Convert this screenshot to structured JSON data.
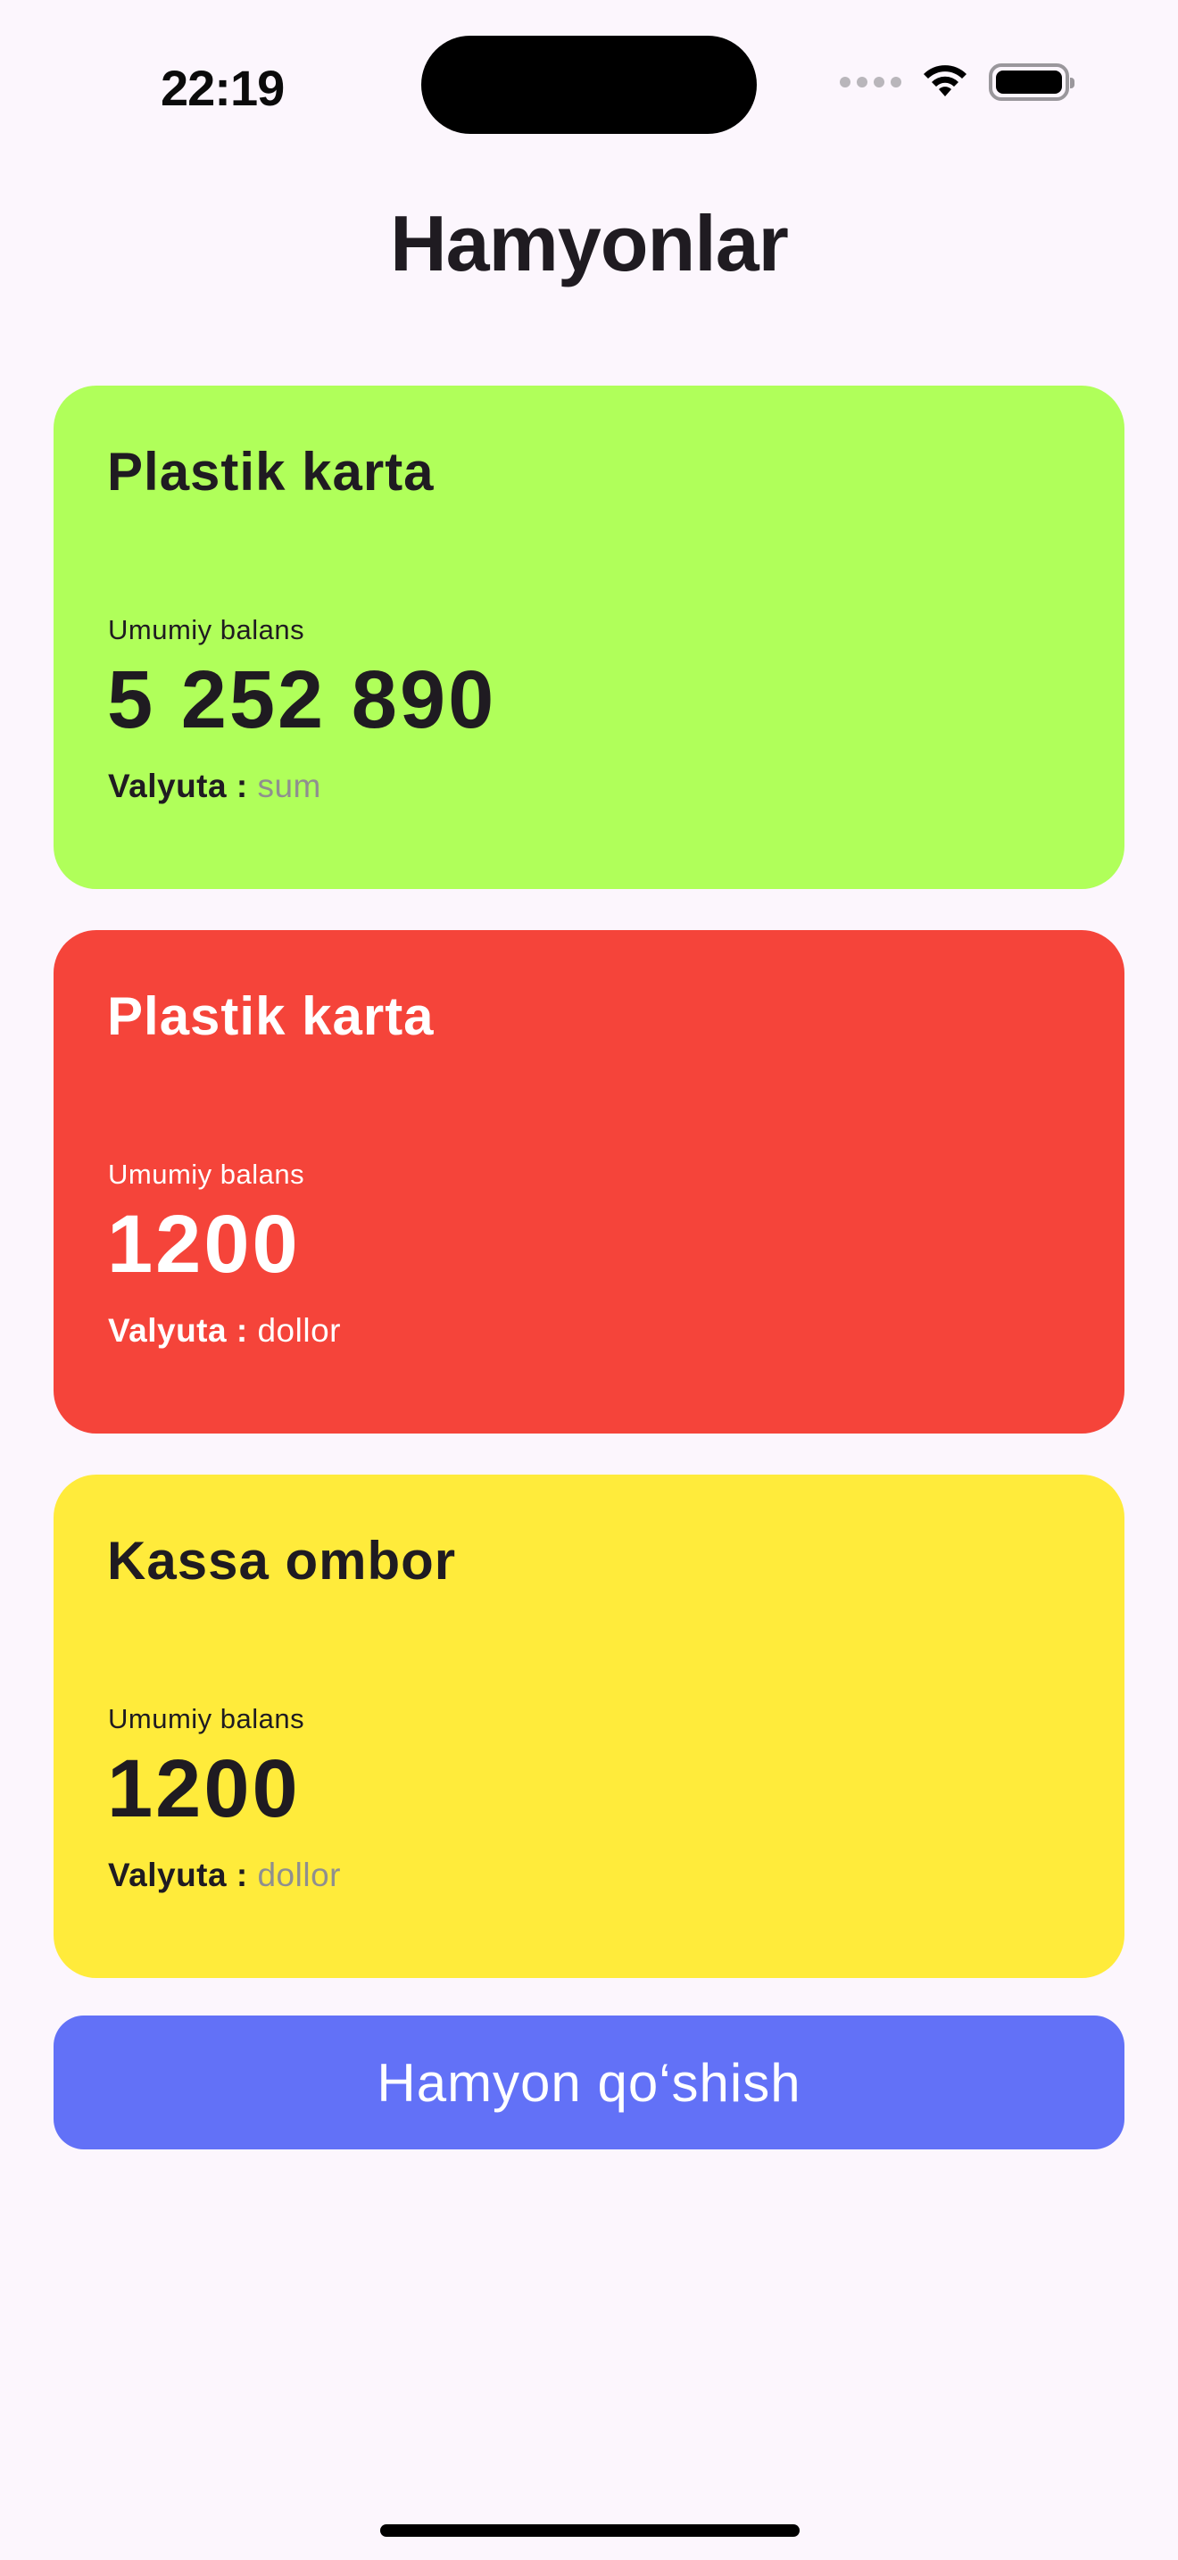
{
  "status_bar": {
    "time": "22:19"
  },
  "header": {
    "title": "Hamyonlar"
  },
  "wallets": [
    {
      "name": "Plastik karta",
      "balance_label": "Umumiy balans",
      "balance": "5 252 890",
      "currency_label": "Valyuta :",
      "currency": "sum",
      "background": "#b0ff5a",
      "text_color": "#1f1b21",
      "currency_color": "#8f8f8f"
    },
    {
      "name": "Plastik karta",
      "balance_label": "Umumiy balans",
      "balance": "1200",
      "currency_label": "Valyuta :",
      "currency": "dollor",
      "background": "#f5443a",
      "text_color": "#ffffff",
      "currency_color": "#ffffff"
    },
    {
      "name": "Kassa ombor",
      "balance_label": "Umumiy balans",
      "balance": "1200",
      "currency_label": "Valyuta :",
      "currency": "dollor",
      "background": "#ffeb3b",
      "text_color": "#1f1b21",
      "currency_color": "#8f8f8f"
    }
  ],
  "actions": {
    "add_wallet_label": "Hamyon qo‘shish",
    "add_wallet_color": "#6271f7"
  },
  "icons": {
    "signal": "cellular-signal-icon",
    "wifi": "wifi-icon",
    "battery": "battery-icon"
  }
}
